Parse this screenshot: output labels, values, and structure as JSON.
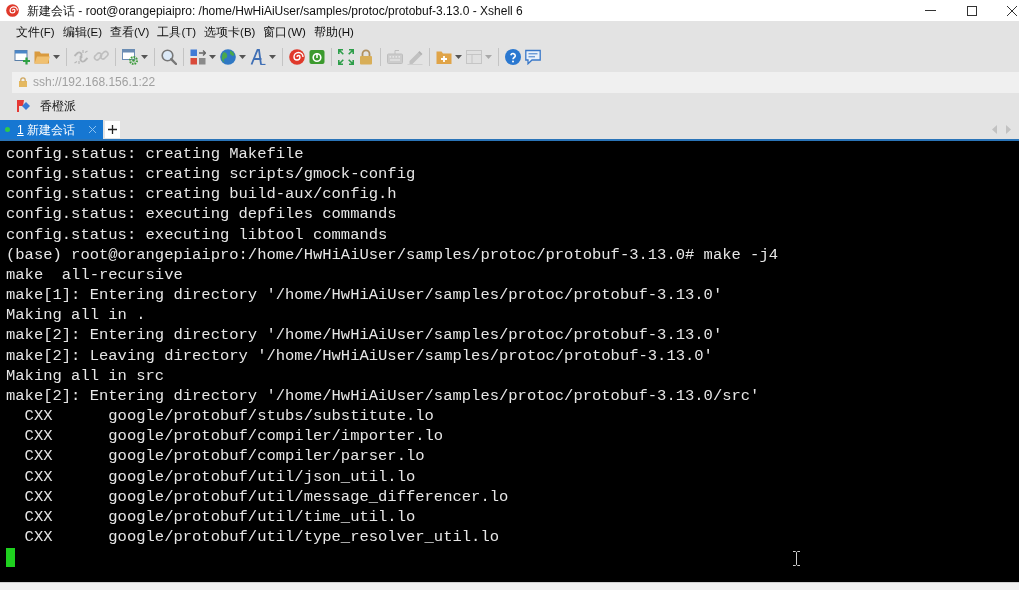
{
  "window": {
    "title": "新建会话 - root@orangepiaipro: /home/HwHiAiUser/samples/protoc/protobuf-3.13.0 - Xshell 6"
  },
  "menu": [
    "文件(F)",
    "编辑(E)",
    "查看(V)",
    "工具(T)",
    "选项卡(B)",
    "窗口(W)",
    "帮助(H)"
  ],
  "toolbar": [
    [
      {
        "disabled": false,
        "dropdown": false
      },
      {
        "disabled": false,
        "dropdown": true
      }
    ],
    [
      {
        "disabled": true,
        "dropdown": false
      },
      {
        "disabled": true,
        "dropdown": false
      }
    ],
    [
      {
        "disabled": false,
        "dropdown": true
      }
    ],
    [
      {
        "disabled": false,
        "dropdown": false
      }
    ],
    [
      {
        "disabled": false,
        "dropdown": true
      },
      {
        "disabled": false,
        "dropdown": true
      },
      {
        "disabled": false,
        "dropdown": true
      }
    ],
    [
      {
        "disabled": false,
        "dropdown": false
      },
      {
        "disabled": false,
        "dropdown": false
      }
    ],
    [
      {
        "disabled": false,
        "dropdown": false
      },
      {
        "disabled": false,
        "dropdown": false
      }
    ],
    [
      {
        "disabled": true,
        "dropdown": false
      },
      {
        "disabled": true,
        "dropdown": false
      }
    ],
    [
      {
        "disabled": false,
        "dropdown": true
      },
      {
        "disabled": true,
        "dropdown": true
      }
    ],
    [
      {
        "disabled": false,
        "dropdown": false
      },
      {
        "disabled": false,
        "dropdown": false
      }
    ]
  ],
  "address": {
    "value": "ssh://192.168.156.1:22"
  },
  "bookmarks": [
    {
      "label": "香橙派"
    }
  ],
  "tabs": [
    {
      "number": "1",
      "label": "新建会话",
      "selected": true,
      "connected": true
    }
  ],
  "tab_scroll": {
    "disabled": true
  },
  "terminal": {
    "lines": [
      "config.status: creating Makefile",
      "config.status: creating scripts/gmock-config",
      "config.status: creating build-aux/config.h",
      "config.status: executing depfiles commands",
      "config.status: executing libtool commands",
      "(base) root@orangepiaipro:/home/HwHiAiUser/samples/protoc/protobuf-3.13.0# make -j4",
      "make  all-recursive",
      "make[1]: Entering directory '/home/HwHiAiUser/samples/protoc/protobuf-3.13.0'",
      "Making all in .",
      "make[2]: Entering directory '/home/HwHiAiUser/samples/protoc/protobuf-3.13.0'",
      "make[2]: Leaving directory '/home/HwHiAiUser/samples/protoc/protobuf-3.13.0'",
      "Making all in src",
      "make[2]: Entering directory '/home/HwHiAiUser/samples/protoc/protobuf-3.13.0/src'",
      "  CXX      google/protobuf/stubs/substitute.lo",
      "  CXX      google/protobuf/compiler/importer.lo",
      "  CXX      google/protobuf/compiler/parser.lo",
      "  CXX      google/protobuf/util/json_util.lo",
      "  CXX      google/protobuf/util/message_differencer.lo",
      "  CXX      google/protobuf/util/time_util.lo",
      "  CXX      google/protobuf/util/type_resolver_util.lo"
    ],
    "cursor": true
  }
}
